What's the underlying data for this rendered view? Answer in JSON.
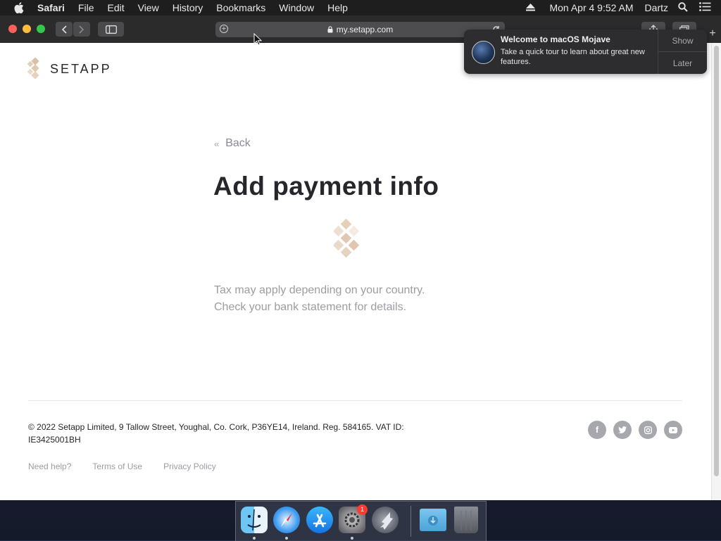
{
  "menubar": {
    "app_name": "Safari",
    "items": [
      "File",
      "Edit",
      "View",
      "History",
      "Bookmarks",
      "Window",
      "Help"
    ],
    "clock": "Mon Apr 4  9:52 AM",
    "user": "Dartz"
  },
  "browser": {
    "url": "my.setapp.com"
  },
  "page": {
    "brand": "SETAPP",
    "back_label": "Back",
    "heading": "Add payment info",
    "note_line1": "Tax may apply depending on your country.",
    "note_line2": "Check your bank statement for details.",
    "copyright": "© 2022 Setapp Limited, 9 Tallow Street, Youghal, Co. Cork, P36YE14, Ireland. Reg. 584165. VAT ID: IE3425001BH",
    "footer_links": [
      "Need help?",
      "Terms of Use",
      "Privacy Policy"
    ],
    "social_icons": [
      "facebook-icon",
      "twitter-icon",
      "instagram-icon",
      "youtube-icon"
    ],
    "brand_color": "#dcc0a3"
  },
  "notification": {
    "title": "Welcome to macOS Mojave",
    "body": "Take a quick tour to learn about great new features.",
    "show_label": "Show",
    "later_label": "Later"
  },
  "dock": {
    "apps": [
      "Finder",
      "Safari",
      "App Store",
      "System Preferences",
      "Launchpad",
      "Downloads",
      "Trash"
    ],
    "badge": "1"
  }
}
